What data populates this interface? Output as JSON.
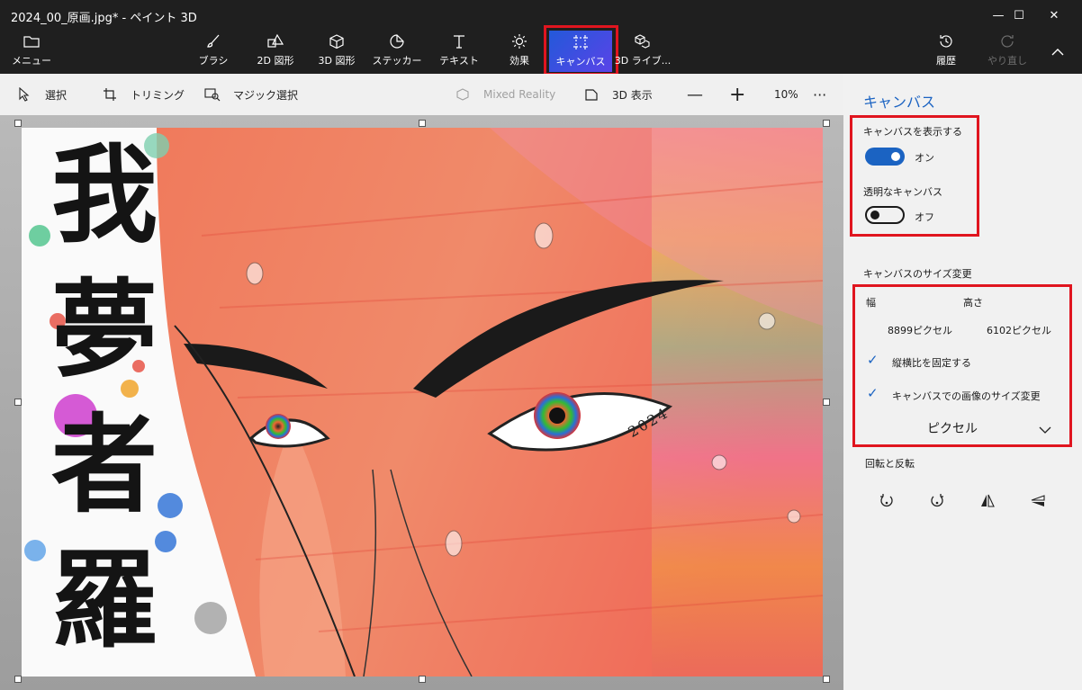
{
  "window": {
    "title": "2024_00_原画.jpg* - ペイント 3D",
    "controls": {
      "minimize": "—",
      "maximize": "☐",
      "close": "✕"
    }
  },
  "ribbon": {
    "menu_label": "メニュー",
    "tools": [
      {
        "label": "ブラシ",
        "icon": "brush-icon"
      },
      {
        "label": "2D 図形",
        "icon": "2d-shapes-icon"
      },
      {
        "label": "3D 図形",
        "icon": "3d-shapes-icon"
      },
      {
        "label": "ステッカー",
        "icon": "sticker-icon"
      },
      {
        "label": "テキスト",
        "icon": "text-icon"
      },
      {
        "label": "効果",
        "icon": "effects-icon"
      },
      {
        "label": "キャンバス",
        "icon": "canvas-icon",
        "active": true
      },
      {
        "label": "3D ライブ...",
        "icon": "3d-library-icon"
      }
    ],
    "history_label": "履歴",
    "redo_label": "やり直し"
  },
  "toolbar": {
    "select": "選択",
    "crop": "トリミング",
    "magic_select": "マジック選択",
    "mixed_reality": "Mixed Reality",
    "view_3d": "3D 表示",
    "zoom_out": "—",
    "zoom_in": "+",
    "zoom_level": "10%",
    "more": "···"
  },
  "panel": {
    "heading": "キャンバス",
    "show_canvas": {
      "label": "キャンバスを表示する",
      "state": "オン",
      "on": true
    },
    "transparent_canvas": {
      "label": "透明なキャンバス",
      "state": "オフ",
      "on": false
    },
    "resize_heading": "キャンバスのサイズ変更",
    "width_label": "幅",
    "height_label": "高さ",
    "width_value": "8899ピクセル",
    "height_value": "6102ピクセル",
    "lock_aspect": "縦横比を固定する",
    "resize_image": "キャンバスでの画像のサイズ変更",
    "unit": "ピクセル",
    "rotate_heading": "回転と反転"
  },
  "artwork": {
    "calligraphy": [
      "我",
      "夢",
      "者",
      "羅"
    ],
    "year": "2024"
  },
  "colors": {
    "accent": "#1b63c2",
    "highlight": "#e0151f",
    "ribbon_active_start": "#2359d9",
    "ribbon_active_end": "#5a43e8"
  }
}
